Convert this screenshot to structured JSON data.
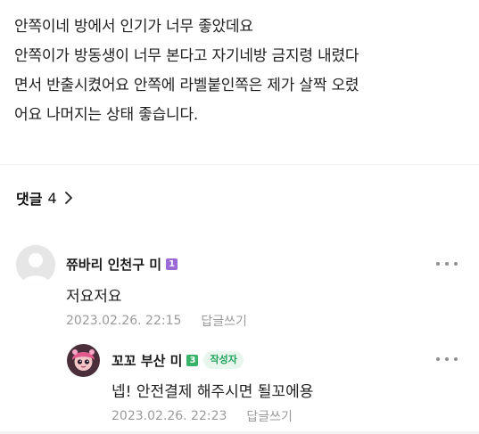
{
  "post": {
    "lines": [
      "안쪽이네 방에서 인기가 너무 좋았데요",
      "안쪽이가 방동생이 너무 본다고 자기네방 금지령 내렸다",
      "면서 반출시켰어요 안쪽에 라벨붙인쪽은 제가 살짝 오렸",
      "어요 나머지는 상태 좋습니다."
    ]
  },
  "comments_header": {
    "title": "댓글",
    "count": "4"
  },
  "comments": [
    {
      "nickname": "쮸바리 인천구 미",
      "level": "1",
      "level_color": "#9b6ad6",
      "text": "저요저요",
      "date": "2023.02.26. 22:15",
      "reply_label": "답글쓰기"
    },
    {
      "nickname": "꼬꼬 부산 미",
      "level": "3",
      "level_color": "#36b26b",
      "author_badge": "작성자",
      "text": "넵! 안전결제 해주시면 될꼬에용",
      "date": "2023.02.26. 22:23",
      "reply_label": "답글쓰기"
    }
  ],
  "colors": {
    "author_badge_bg": "#e8f6ee",
    "author_badge_text": "#1ea35a",
    "meta_text": "#9a9a9a"
  }
}
